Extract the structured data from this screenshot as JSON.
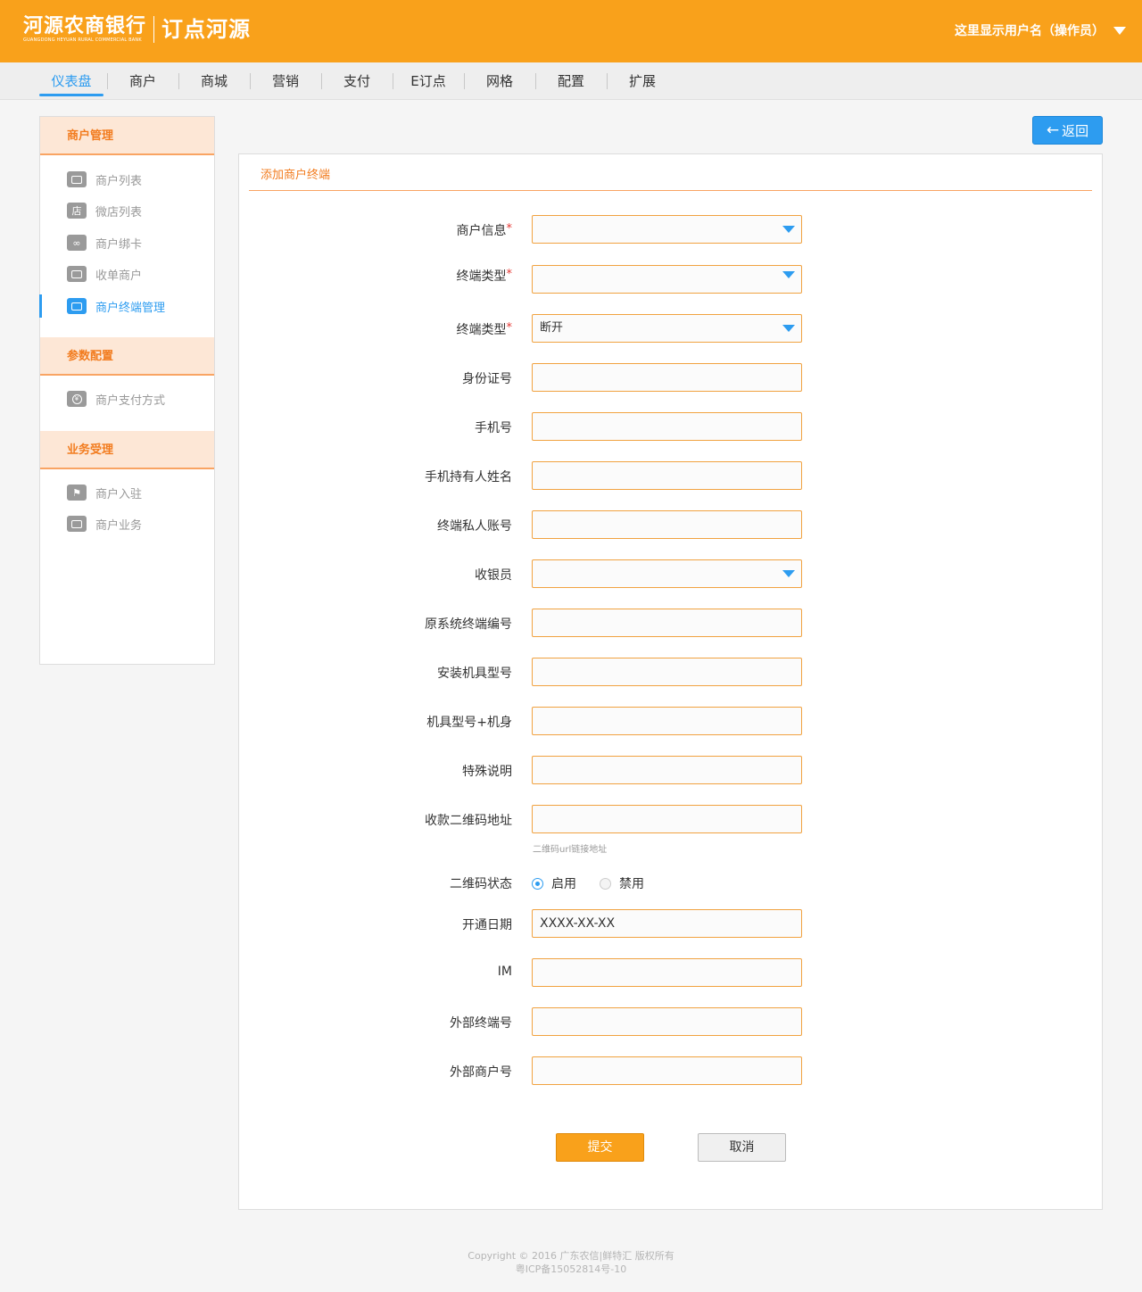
{
  "header": {
    "bank_name": "河源农商银行",
    "bank_name_en": "GUANGDONG HEYUAN RURAL COMMERCIAL BANK",
    "app_name": "订点河源",
    "user_label": "这里显示用户名（操作员）",
    "brand_color": "#f9a11b"
  },
  "nav": {
    "items": [
      {
        "label": "仪表盘",
        "active": true
      },
      {
        "label": "商户"
      },
      {
        "label": "商城"
      },
      {
        "label": "营销"
      },
      {
        "label": "支付"
      },
      {
        "label": "E订点"
      },
      {
        "label": "网格"
      },
      {
        "label": "配置"
      },
      {
        "label": "扩展"
      }
    ],
    "accent": "#2d9cf0"
  },
  "sidebar": {
    "groups": [
      {
        "title": "商户管理",
        "items": [
          {
            "label": "商户列表",
            "icon": "store-icon"
          },
          {
            "label": "微店列表",
            "icon": "shop-icon"
          },
          {
            "label": "商户绑卡",
            "icon": "link-icon"
          },
          {
            "label": "收单商户",
            "icon": "receipt-icon"
          },
          {
            "label": "商户终端管理",
            "icon": "terminal-icon",
            "active": true
          }
        ]
      },
      {
        "title": "参数配置",
        "items": [
          {
            "label": "商户支付方式",
            "icon": "yuan-icon"
          }
        ]
      },
      {
        "title": "业务受理",
        "items": [
          {
            "label": "商户入驻",
            "icon": "flag-icon"
          },
          {
            "label": "商户业务",
            "icon": "briefcase-icon"
          }
        ]
      }
    ]
  },
  "toolbar": {
    "back_label": "返回",
    "back_icon": "arrow-left-icon"
  },
  "form": {
    "title": "添加商户终端",
    "fields": [
      {
        "label": "商户信息",
        "required": true,
        "type": "select",
        "value": ""
      },
      {
        "label": "终端类型",
        "required": true,
        "type": "select",
        "value": ""
      },
      {
        "label": "终端类型",
        "required": true,
        "type": "select",
        "value": "断开"
      },
      {
        "label": "身份证号",
        "type": "text",
        "value": ""
      },
      {
        "label": "手机号",
        "type": "text",
        "value": ""
      },
      {
        "label": "手机持有人姓名",
        "type": "text",
        "value": ""
      },
      {
        "label": "终端私人账号",
        "type": "text",
        "value": ""
      },
      {
        "label": "收银员",
        "type": "select",
        "value": ""
      },
      {
        "label": "原系统终端编号",
        "type": "text",
        "value": ""
      },
      {
        "label": "安装机具型号",
        "type": "text",
        "value": ""
      },
      {
        "label": "机具型号+机身",
        "type": "text",
        "value": ""
      },
      {
        "label": "特殊说明",
        "type": "text",
        "value": ""
      },
      {
        "label": "收款二维码地址",
        "type": "text",
        "value": ""
      }
    ],
    "qr_hint": "二维码url链接地址",
    "qr_status": {
      "label": "二维码状态",
      "options": [
        "启用",
        "禁用"
      ],
      "selected": "启用"
    },
    "open_date": {
      "label": "开通日期",
      "value": "XXXX-XX-XX"
    },
    "im": {
      "label": "IM",
      "value": ""
    },
    "external_terminal": {
      "label": "外部终端号",
      "value": ""
    },
    "external_merchant": {
      "label": "外部商户号",
      "value": ""
    },
    "submit_label": "提交",
    "cancel_label": "取消"
  },
  "footer": {
    "copyright": "Copyright © 2016 广东农信|鲜特汇 版权所有",
    "icp": "粤ICP备15052814号-10"
  }
}
